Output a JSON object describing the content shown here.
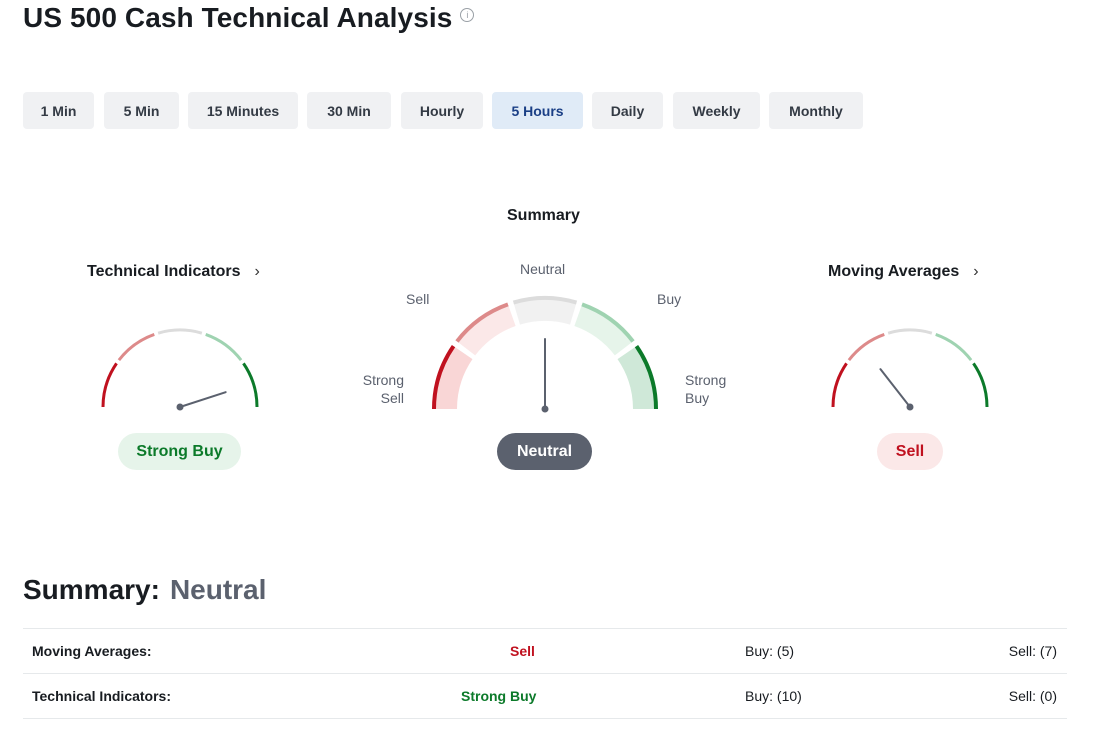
{
  "page": {
    "title": "US 500 Cash Technical Analysis",
    "info_icon": "info-icon"
  },
  "tabs": [
    {
      "label": "1 Min",
      "active": false
    },
    {
      "label": "5 Min",
      "active": false
    },
    {
      "label": "15 Minutes",
      "active": false
    },
    {
      "label": "30 Min",
      "active": false
    },
    {
      "label": "Hourly",
      "active": false
    },
    {
      "label": "5 Hours",
      "active": true
    },
    {
      "label": "Daily",
      "active": false
    },
    {
      "label": "Weekly",
      "active": false
    },
    {
      "label": "Monthly",
      "active": false
    }
  ],
  "gauges": {
    "technical": {
      "title": "Technical Indicators",
      "icon": "chevron-right-icon",
      "result": "Strong Buy"
    },
    "summary": {
      "title": "Summary",
      "labels": {
        "strong_sell": [
          "Strong",
          "Sell"
        ],
        "sell": "Sell",
        "neutral": "Neutral",
        "buy": "Buy",
        "strong_buy": [
          "Strong",
          "Buy"
        ]
      },
      "result": "Neutral"
    },
    "moving": {
      "title": "Moving Averages",
      "icon": "chevron-right-icon",
      "result": "Sell"
    }
  },
  "colors": {
    "strong_sell": "#c0111f",
    "sell": "#dd8a8a",
    "neutral": "#dcdcdc",
    "buy": "#9fd3b1",
    "strong_buy": "#0c7a2a",
    "needle": "#5b616e"
  },
  "summary_table": {
    "heading": "Summary:",
    "value": "Neutral",
    "rows": [
      {
        "name": "Moving Averages:",
        "signal": "Sell",
        "buy": "Buy: (5)",
        "sell": "Sell: (7)"
      },
      {
        "name": "Technical Indicators:",
        "signal": "Strong Buy",
        "buy": "Buy: (10)",
        "sell": "Sell: (0)"
      }
    ]
  }
}
